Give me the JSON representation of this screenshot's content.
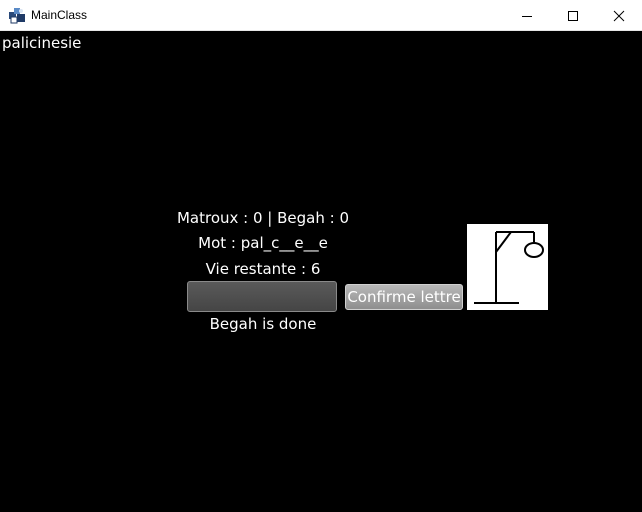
{
  "window": {
    "title": "MainClass"
  },
  "game": {
    "secret_word": "palicinesie",
    "score_line": "Matroux : 0 | Begah : 0",
    "word_line": "Mot : pal_c__e__e",
    "lives_line": "Vie restante : 6",
    "letter_input_value": "",
    "confirm_label": "Confirme lettre",
    "status_line": "Begah is done",
    "hangman_icon": "hangman-gallows-icon"
  },
  "colors": {
    "background": "#000000",
    "text": "#ffffff",
    "titlebar": "#ffffff"
  }
}
